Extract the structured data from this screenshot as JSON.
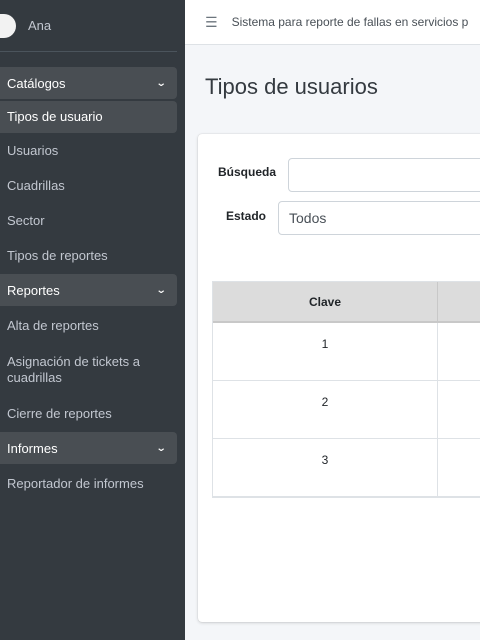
{
  "user": {
    "name": "Ana"
  },
  "topbar": {
    "menu_icon": "hamburger-icon",
    "title": "Sistema para reporte de fallas en servicios p"
  },
  "sidebar": {
    "sections": [
      {
        "label": "Catálogos",
        "items": [
          "Tipos de usuario",
          "Usuarios",
          "Cuadrillas",
          "Sector",
          "Tipos de reportes"
        ]
      },
      {
        "label": "Reportes",
        "items": [
          "Alta de reportes",
          "Asignación de tickets a cuadrillas",
          "Cierre de reportes"
        ]
      },
      {
        "label": "Informes",
        "items": [
          "Reportador de informes"
        ]
      }
    ],
    "active_item": "Tipos de usuario"
  },
  "page": {
    "title": "Tipos de usuarios"
  },
  "filters": {
    "search_label": "Búsqueda",
    "search_value": "",
    "estado_label": "Estado",
    "estado_value": "Todos"
  },
  "table": {
    "headers": [
      "Clave",
      ""
    ],
    "rows": [
      [
        "1",
        ""
      ],
      [
        "2",
        ""
      ],
      [
        "3",
        ""
      ]
    ]
  },
  "colors": {
    "sidebar_bg": "#343a40",
    "sidebar_active": "#494e53",
    "table_header_bg": "#dcdcdc"
  }
}
